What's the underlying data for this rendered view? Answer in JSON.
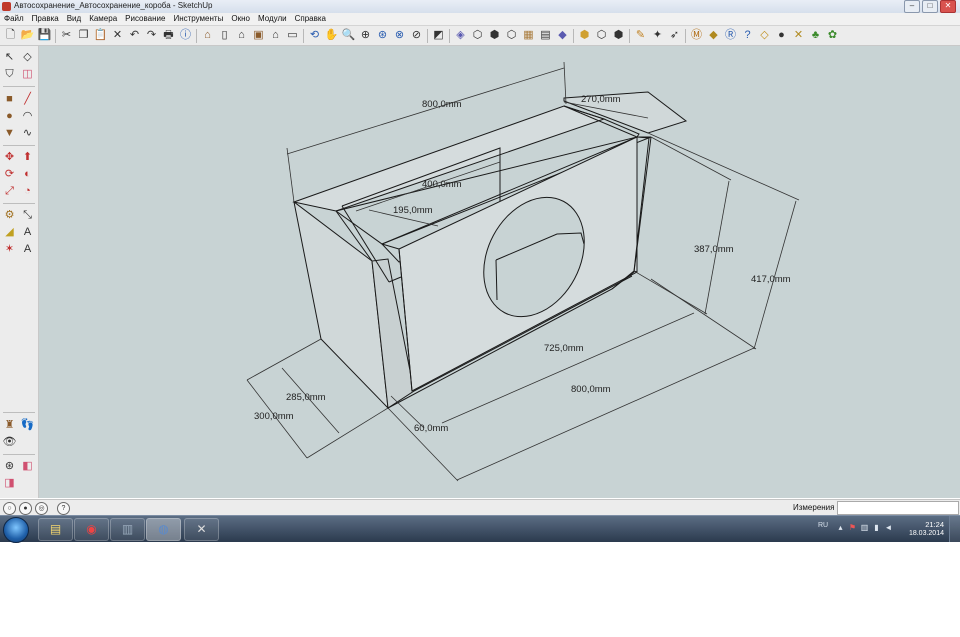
{
  "window": {
    "title": "Автосохранение_Автосохранение_короба - SketchUp",
    "min": "–",
    "max": "□",
    "close": "✕"
  },
  "menu": [
    "Файл",
    "Правка",
    "Вид",
    "Камера",
    "Рисование",
    "Инструменты",
    "Окно",
    "Модули",
    "Справка"
  ],
  "toolbar_icons": [
    "new-icon",
    "open-icon",
    "save-icon",
    "cut-icon",
    "copy-icon",
    "paste-icon",
    "erase-icon",
    "undo-icon",
    "redo-icon",
    "print-icon",
    "model-info-icon",
    "iso-view-icon",
    "top-view-icon",
    "front-view-icon",
    "right-view-icon",
    "back-view-icon",
    "left-view-icon",
    "orbit-icon",
    "pan-icon",
    "zoom-icon",
    "zoom-window-icon",
    "zoom-extents-icon",
    "previous-view-icon",
    "section-plane-icon",
    "xray-icon",
    "wireframe-icon",
    "hidden-line-icon",
    "shaded-icon",
    "shaded-textures-icon",
    "monochrome-icon",
    "components-icon",
    "materials-icon",
    "styles-icon",
    "paint-icon",
    "walk-icon",
    "position-camera-icon",
    "plugin-m-icon",
    "tag-icon",
    "plugin-r-icon",
    "help-icon",
    "plugin-tag-icon",
    "sphere-icon",
    "plugin-x-icon",
    "plugin-tree-icon",
    "plugin-flower-icon"
  ],
  "viewport": {
    "dimensions": [
      {
        "label": "800,0mm"
      },
      {
        "label": "270,0mm"
      },
      {
        "label": "400,0mm"
      },
      {
        "label": "195,0mm"
      },
      {
        "label": "387,0mm"
      },
      {
        "label": "417,0mm"
      },
      {
        "label": "725,0mm"
      },
      {
        "label": "800,0mm"
      },
      {
        "label": "285,0mm"
      },
      {
        "label": "300,0mm"
      },
      {
        "label": "60,0mm"
      }
    ]
  },
  "statusbar": {
    "measurements_label": "Измерения",
    "measurements_value": "",
    "help": "?"
  },
  "taskbar": {
    "lang": "RU",
    "time": "21:24",
    "date": "18.03.2014"
  }
}
